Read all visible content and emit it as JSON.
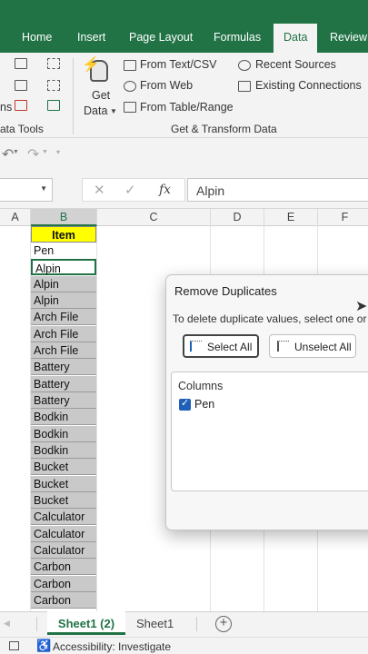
{
  "ribbon_tabs": [
    "Home",
    "Insert",
    "Page Layout",
    "Formulas",
    "Data",
    "Review"
  ],
  "active_tab": "Data",
  "ribbon": {
    "data_tools_label": "ata Tools",
    "ns_label": "ns",
    "get_data_line1": "Get",
    "get_data_line2": "Data",
    "from_text_csv": "From Text/CSV",
    "from_web": "From Web",
    "from_table_range": "From Table/Range",
    "recent_sources": "Recent Sources",
    "existing_connections": "Existing Connections",
    "group_label": "Get & Transform Data"
  },
  "formula_bar": {
    "value": "Alpin",
    "fx": "fx"
  },
  "columns": [
    "A",
    "B",
    "C",
    "D",
    "E",
    "F"
  ],
  "cells": {
    "header": "Item",
    "values": [
      "Pen",
      "Alpin",
      "Alpin",
      "Alpin",
      "Arch File",
      "Arch File",
      "Arch File",
      "Battery",
      "Battery",
      "Battery",
      "Bodkin",
      "Bodkin",
      "Bodkin",
      "Bucket",
      "Bucket",
      "Bucket",
      "Calculator",
      "Calculator",
      "Calculator",
      "Carbon",
      "Carbon",
      "Carbon"
    ]
  },
  "dialog": {
    "title": "Remove Duplicates",
    "description": "To delete duplicate values, select one or m",
    "select_all": "Select All",
    "unselect_all": "Unselect All",
    "columns_label": "Columns",
    "column_item": "Pen",
    "column_checked": true
  },
  "sheet_tabs": [
    "Sheet1 (2)",
    "Sheet1"
  ],
  "active_sheet": "Sheet1 (2)",
  "status": {
    "accessibility": "Accessibility: Investigate"
  },
  "colors": {
    "excel_green": "#217346",
    "header_yellow": "#ffff00",
    "checkbox_blue": "#1f5fb7"
  }
}
